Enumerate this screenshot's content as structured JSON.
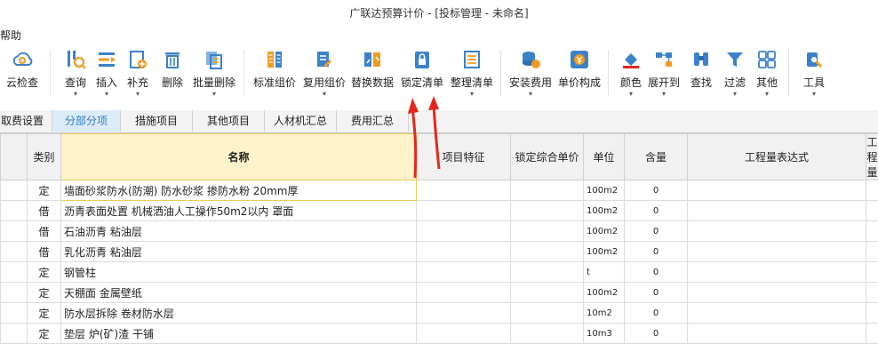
{
  "window": {
    "title": "广联达预算计价 - [投标管理 - 未命名]"
  },
  "menu": {
    "help": "帮助"
  },
  "toolbar": {
    "buttons": [
      {
        "label": "云检查",
        "icon": "cloud-check-icon",
        "caret": false
      },
      {
        "label": "查询",
        "icon": "query-icon",
        "caret": true
      },
      {
        "label": "插入",
        "icon": "insert-icon",
        "caret": true
      },
      {
        "label": "补充",
        "icon": "supplement-icon",
        "caret": true
      },
      {
        "label": "删除",
        "icon": "delete-icon",
        "caret": false
      },
      {
        "label": "批量删除",
        "icon": "batch-delete-icon",
        "caret": true
      },
      {
        "label": "标准组价",
        "icon": "standard-pricing-icon",
        "caret": false
      },
      {
        "label": "复用组价",
        "icon": "reuse-pricing-icon",
        "caret": true
      },
      {
        "label": "替换数据",
        "icon": "replace-data-icon",
        "caret": false
      },
      {
        "label": "锁定清单",
        "icon": "lock-list-icon",
        "caret": false
      },
      {
        "label": "整理清单",
        "icon": "organize-list-icon",
        "caret": true
      },
      {
        "label": "安装费用",
        "icon": "install-cost-icon",
        "caret": true
      },
      {
        "label": "单价构成",
        "icon": "unit-price-icon",
        "caret": false
      },
      {
        "label": "颜色",
        "icon": "color-icon",
        "caret": true
      },
      {
        "label": "展开到",
        "icon": "expand-to-icon",
        "caret": true
      },
      {
        "label": "查找",
        "icon": "find-icon",
        "caret": false
      },
      {
        "label": "过滤",
        "icon": "filter-icon",
        "caret": true
      },
      {
        "label": "其他",
        "icon": "other-icon",
        "caret": true
      },
      {
        "label": "工具",
        "icon": "tools-icon",
        "caret": true
      }
    ]
  },
  "tabs": [
    {
      "label": "取费设置",
      "active": false
    },
    {
      "label": "分部分项",
      "active": true
    },
    {
      "label": "措施项目",
      "active": false
    },
    {
      "label": "其他项目",
      "active": false
    },
    {
      "label": "人材机汇总",
      "active": false
    },
    {
      "label": "费用汇总",
      "active": false
    }
  ],
  "table": {
    "headers": [
      "类别",
      "名称",
      "项目特征",
      "锁定综合单价",
      "单位",
      "含量",
      "工程量表达式",
      "工程量"
    ],
    "rows": [
      {
        "type": "定",
        "name": "墙面砂浆防水(防潮) 防水砂浆 掺防水粉 20mm厚",
        "feature": "",
        "locked_price": "",
        "unit": "100m2",
        "qty": "0",
        "expr": "",
        "amount": ""
      },
      {
        "type": "借",
        "name": "沥青表面处置 机械洒油人工操作50m2以内 罩面",
        "feature": "",
        "locked_price": "",
        "unit": "100m2",
        "qty": "0",
        "expr": "",
        "amount": ""
      },
      {
        "type": "借",
        "name": "石油沥青 粘油层",
        "feature": "",
        "locked_price": "",
        "unit": "100m2",
        "qty": "0",
        "expr": "",
        "amount": ""
      },
      {
        "type": "借",
        "name": "乳化沥青 粘油层",
        "feature": "",
        "locked_price": "",
        "unit": "100m2",
        "qty": "0",
        "expr": "",
        "amount": ""
      },
      {
        "type": "定",
        "name": "钢管柱",
        "feature": "",
        "locked_price": "",
        "unit": "t",
        "qty": "0",
        "expr": "",
        "amount": ""
      },
      {
        "type": "定",
        "name": "天棚面 金属壁纸",
        "feature": "",
        "locked_price": "",
        "unit": "100m2",
        "qty": "0",
        "expr": "",
        "amount": ""
      },
      {
        "type": "定",
        "name": "防水层拆除 卷材防水层",
        "feature": "",
        "locked_price": "",
        "unit": "10m2",
        "qty": "0",
        "expr": "",
        "amount": ""
      },
      {
        "type": "定",
        "name": "垫层 炉(矿)渣 干铺",
        "feature": "",
        "locked_price": "",
        "unit": "10m3",
        "qty": "0",
        "expr": "",
        "amount": ""
      }
    ]
  },
  "colors": {
    "accent": "#2f7fc8",
    "icon_blue": "#3b82c8",
    "icon_orange": "#f29a1f",
    "arrow": "#e8261c",
    "name_header": "#fdf2c9"
  }
}
